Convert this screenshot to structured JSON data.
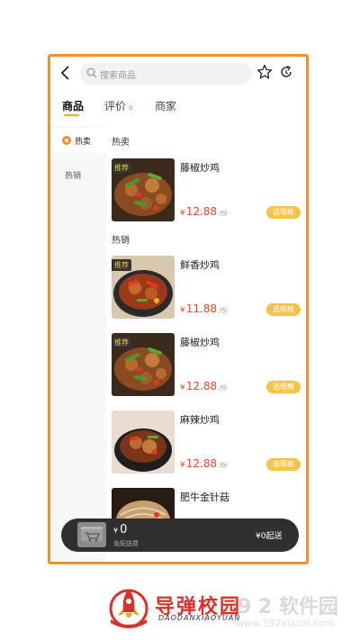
{
  "header": {
    "search_placeholder": "搜索商品"
  },
  "tabs": [
    {
      "label": "商品"
    },
    {
      "label": "评价",
      "count": "0"
    },
    {
      "label": "商家"
    }
  ],
  "sidebar": {
    "items": [
      {
        "label": "热卖"
      },
      {
        "label": "热销"
      }
    ]
  },
  "sections": [
    {
      "title": "热卖"
    },
    {
      "title": "热销"
    }
  ],
  "products": [
    {
      "name": "藤椒炒鸡",
      "tag": "推荐",
      "currency": "¥",
      "price": "12.88",
      "unit": "/份",
      "button": "选规格"
    },
    {
      "name": "鲜香炒鸡",
      "tag": "推荐",
      "currency": "¥",
      "price": "11.88",
      "unit": "/份",
      "button": "选规格"
    },
    {
      "name": "藤椒炒鸡",
      "tag": "推荐",
      "currency": "¥",
      "price": "12.88",
      "unit": "/份",
      "button": "选规格"
    },
    {
      "name": "麻辣炒鸡",
      "tag": "",
      "currency": "¥",
      "price": "12.88",
      "unit": "/份",
      "button": "选规格"
    },
    {
      "name": "肥牛金针菇",
      "tag": "",
      "currency": "",
      "price": "",
      "unit": "",
      "button": ""
    }
  ],
  "cart": {
    "currency": "¥",
    "amount": "0",
    "note": "免配送费",
    "min_order": "¥0起送"
  },
  "footer": {
    "brand": "导弹校园",
    "brand_sub": "DAODANXIAOYUAN"
  },
  "watermark": {
    "line1": "9 2 软件园",
    "line2": "www.592xiazai.com"
  },
  "colors": {
    "accent": "#f5a623",
    "border": "#f0912c",
    "price": "#e8442a",
    "button": "#f5c34a",
    "cart_bar": "#2f2f2f"
  }
}
